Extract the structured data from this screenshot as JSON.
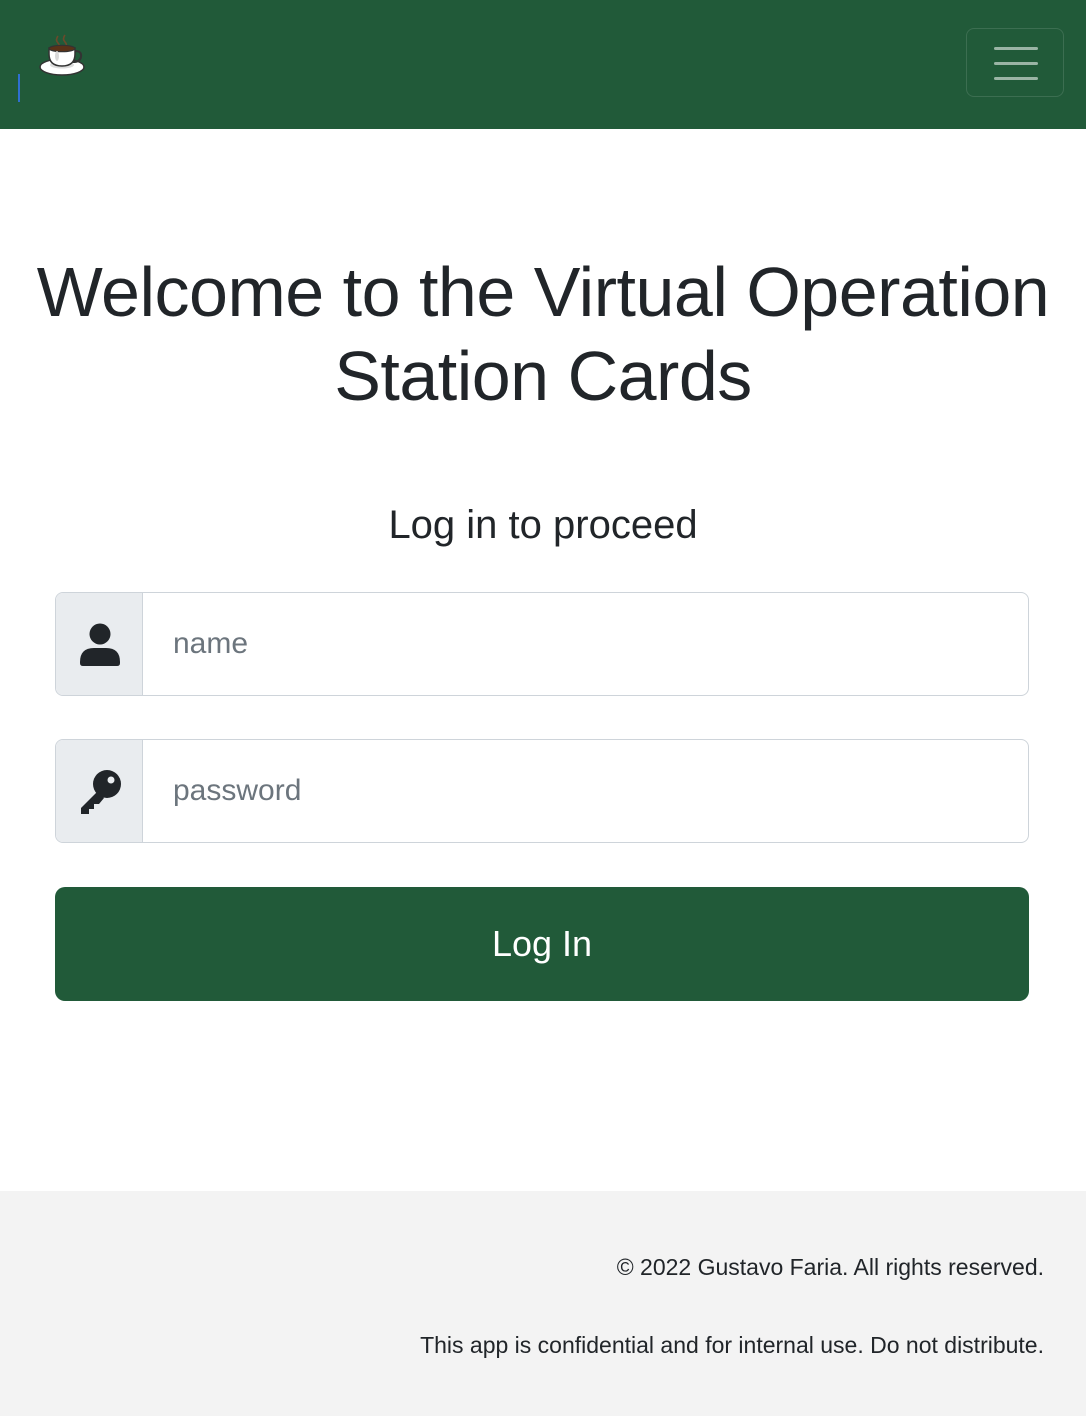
{
  "navbar": {
    "logo_icon": "coffee-cup-icon",
    "menu_icon": "hamburger-menu-icon",
    "background_color": "#215a39"
  },
  "main": {
    "title": "Welcome to the Virtual Operation Station Cards",
    "subtitle": "Log in to proceed",
    "name_field": {
      "icon": "user-icon",
      "placeholder": "name",
      "value": ""
    },
    "password_field": {
      "icon": "key-icon",
      "placeholder": "password",
      "value": ""
    },
    "login_button_label": "Log In",
    "accent_color": "#215a39"
  },
  "footer": {
    "copyright": "© 2022 Gustavo Faria. All rights reserved.",
    "notice": "This app is confidential and for internal use. Do not distribute."
  }
}
